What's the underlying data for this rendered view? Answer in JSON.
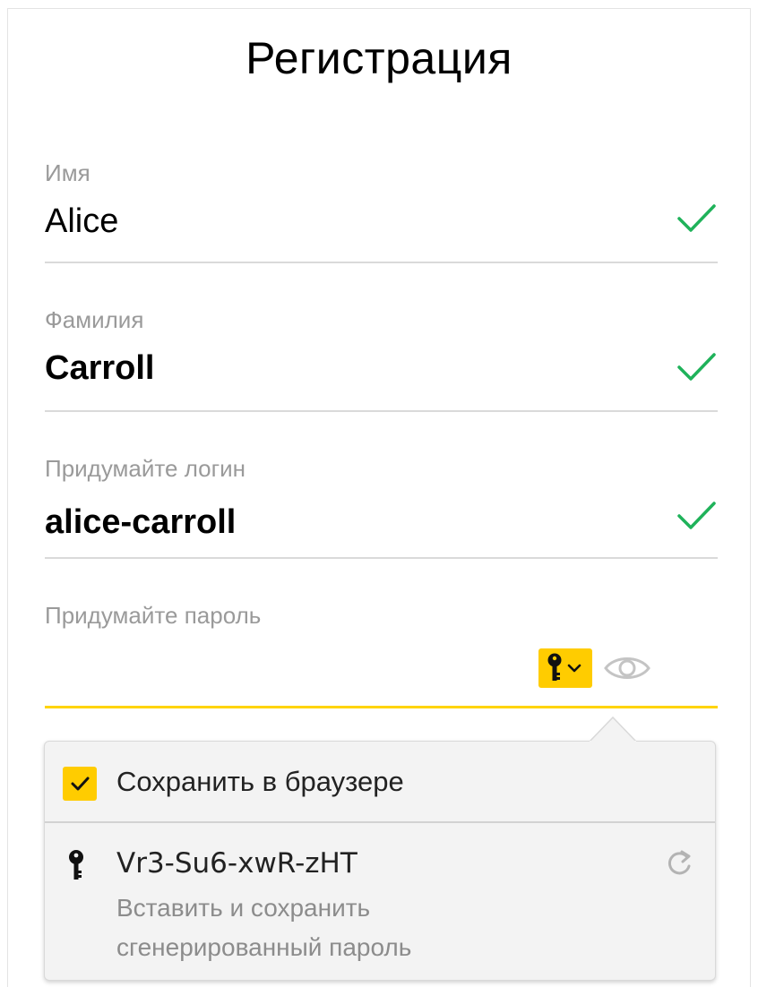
{
  "form": {
    "title": "Регистрация",
    "first_name": {
      "label": "Имя",
      "value": "Alice",
      "valid": true
    },
    "last_name": {
      "label": "Фамилия",
      "value": "Carroll",
      "valid": true
    },
    "login": {
      "label": "Придумайте логин",
      "value": "alice-carroll",
      "valid": true
    },
    "password": {
      "label": "Придумайте пароль",
      "value": ""
    }
  },
  "password_popup": {
    "save_checkbox": {
      "label": "Сохранить в браузере",
      "checked": true
    },
    "generated_password": "Vr3-Su6-xwR-zHT",
    "generated_description_line1": "Вставить и сохранить",
    "generated_description_line2": "сгенерированный пароль"
  },
  "icons": {
    "valid": "check-icon",
    "password_manager": "key-icon",
    "visibility": "eye-icon",
    "regenerate": "refresh-icon"
  },
  "colors": {
    "accent": "#ffcc00",
    "valid": "#1fb25a",
    "label": "#9a9a9a",
    "line": "#dadada"
  }
}
